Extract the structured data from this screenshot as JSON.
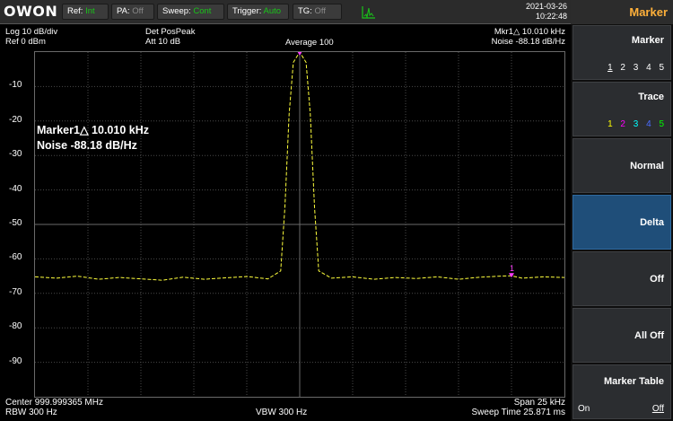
{
  "topbar": {
    "logo": "OWON",
    "chips": [
      {
        "key": "Ref:",
        "value": "Int",
        "state": "on"
      },
      {
        "key": "PA:",
        "value": "Off",
        "state": "off"
      },
      {
        "key": "Sweep:",
        "value": "Cont",
        "state": "on"
      },
      {
        "key": "Trigger:",
        "value": "Auto",
        "state": "on"
      },
      {
        "key": "TG:",
        "value": "Off",
        "state": "off"
      }
    ],
    "date": "2021-03-26",
    "time": "10:22:48"
  },
  "display": {
    "scale": "Log 10 dB/div",
    "ref": "Ref 0 dBm",
    "detector": "Det PosPeak",
    "attenuation": "Att 10 dB",
    "average": "Average 100",
    "marker_readout": "Mkr1△  10.010 kHz",
    "noise_readout": "Noise  -88.18 dB/Hz",
    "big_marker_line": "Marker1△  10.010 kHz",
    "big_noise_line": "Noise  -88.18 dB/Hz",
    "center": "Center 999.999365 MHz",
    "rbw": "RBW 300 Hz",
    "vbw": "VBW 300 Hz",
    "span": "Span 25 kHz",
    "sweep_time": "Sweep Time 25.871 ms",
    "y_tick_labels": [
      "-10",
      "-20",
      "-30",
      "-40",
      "-50",
      "-60",
      "-70",
      "-80",
      "-90"
    ],
    "marker_labels": {
      "ref": "R",
      "m1": "1"
    }
  },
  "sidepanel": {
    "title": "Marker",
    "buttons": [
      {
        "label": "Marker",
        "options": [
          "1",
          "2",
          "3",
          "4",
          "5"
        ],
        "selected": 0
      },
      {
        "label": "Trace",
        "options": [
          "1",
          "2",
          "3",
          "4",
          "5"
        ]
      },
      {
        "label": "Normal"
      },
      {
        "label": "Delta",
        "active": true
      },
      {
        "label": "Off"
      },
      {
        "label": "All Off"
      },
      {
        "label": "Marker Table",
        "on": "On",
        "off": "Off"
      }
    ],
    "trace_colors": [
      "#ffff00",
      "#ff00ff",
      "#00ffff",
      "#4a6cff",
      "#00ff00"
    ]
  },
  "colors": {
    "trace": "#ffff3c",
    "marker": "#ff3cff",
    "active_button": "#1f4e79",
    "title_accent": "#ffb03a",
    "status_green": "#19c419"
  },
  "chart_data": {
    "type": "line",
    "title": "",
    "xlabel": "",
    "ylabel": "",
    "ylim": [
      -100,
      0
    ],
    "x_range_khz": [
      -12.5,
      12.5
    ],
    "x_khz": [
      -12.5,
      -11.5,
      -10.5,
      -9.5,
      -8.5,
      -7.5,
      -6.5,
      -5.5,
      -4.5,
      -3.5,
      -2.5,
      -1.5,
      -0.9,
      -0.7,
      -0.5,
      -0.3,
      0.0,
      0.3,
      0.5,
      0.7,
      0.9,
      1.5,
      2.5,
      3.5,
      4.5,
      5.5,
      6.5,
      7.5,
      8.5,
      9.5,
      10.0,
      10.5,
      11.5,
      12.5
    ],
    "y_dbm": [
      -65.2,
      -65.6,
      -65.0,
      -65.9,
      -65.4,
      -65.8,
      -66.2,
      -65.3,
      -65.9,
      -65.5,
      -65.1,
      -65.8,
      -63.5,
      -45.0,
      -18.0,
      -3.0,
      0.0,
      -3.0,
      -18.0,
      -45.0,
      -63.5,
      -65.6,
      -65.2,
      -65.9,
      -65.4,
      -65.7,
      -65.2,
      -65.9,
      -65.3,
      -65.0,
      -64.9,
      -65.6,
      -65.2,
      -65.4
    ],
    "markers": [
      {
        "name": "R",
        "x_khz": 0.0,
        "y_dbm": -0.5
      },
      {
        "name": "1",
        "x_khz": 10.0,
        "y_dbm": -64.9
      }
    ],
    "grid": true,
    "grid_divisions": {
      "x": 10,
      "y": 10
    }
  }
}
